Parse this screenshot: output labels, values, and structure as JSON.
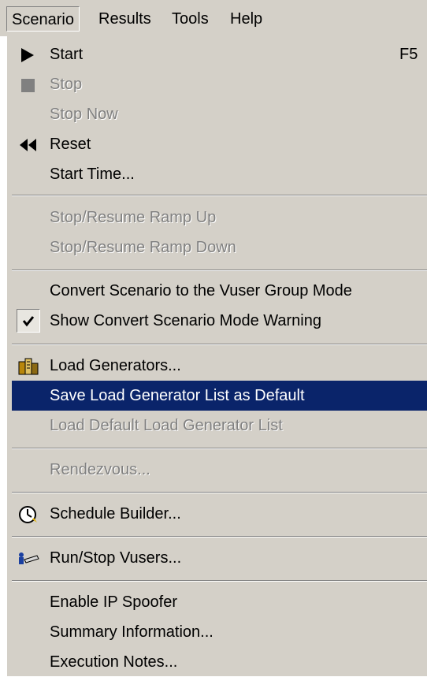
{
  "menubar": {
    "items": [
      {
        "label": "Scenario",
        "open": true
      },
      {
        "label": "Results"
      },
      {
        "label": "Tools"
      },
      {
        "label": "Help"
      }
    ]
  },
  "menu": {
    "start": {
      "label": "Start",
      "shortcut": "F5",
      "icon": "play-icon"
    },
    "stop": {
      "label": "Stop",
      "icon": "stop-icon",
      "enabled": false
    },
    "stop_now": {
      "label": "Stop Now",
      "enabled": false
    },
    "reset": {
      "label": "Reset",
      "icon": "rewind-icon"
    },
    "start_time": {
      "label": "Start Time..."
    },
    "stop_resume_ramp_up": {
      "label": "Stop/Resume Ramp Up",
      "enabled": false
    },
    "stop_resume_ramp_down": {
      "label": "Stop/Resume Ramp Down",
      "enabled": false
    },
    "convert_scenario": {
      "label": "Convert Scenario to the Vuser Group Mode"
    },
    "show_convert_warning": {
      "label": "Show Convert Scenario Mode Warning",
      "checked": true
    },
    "load_generators": {
      "label": "Load Generators...",
      "icon": "load-generators-icon"
    },
    "save_lg_default": {
      "label": "Save Load Generator List as Default",
      "highlighted": true
    },
    "load_default_lg": {
      "label": "Load Default Load Generator List",
      "enabled": false
    },
    "rendezvous": {
      "label": "Rendezvous...",
      "enabled": false
    },
    "schedule_builder": {
      "label": "Schedule Builder...",
      "icon": "clock-icon"
    },
    "run_stop_vusers": {
      "label": "Run/Stop Vusers...",
      "icon": "run-vusers-icon"
    },
    "enable_ip_spoofer": {
      "label": "Enable IP Spoofer"
    },
    "summary_information": {
      "label": "Summary Information..."
    },
    "execution_notes": {
      "label": "Execution Notes..."
    }
  },
  "colors": {
    "menu_face": "#d4d0c8",
    "highlight": "#0a246a",
    "disabled_text": "#808080"
  }
}
